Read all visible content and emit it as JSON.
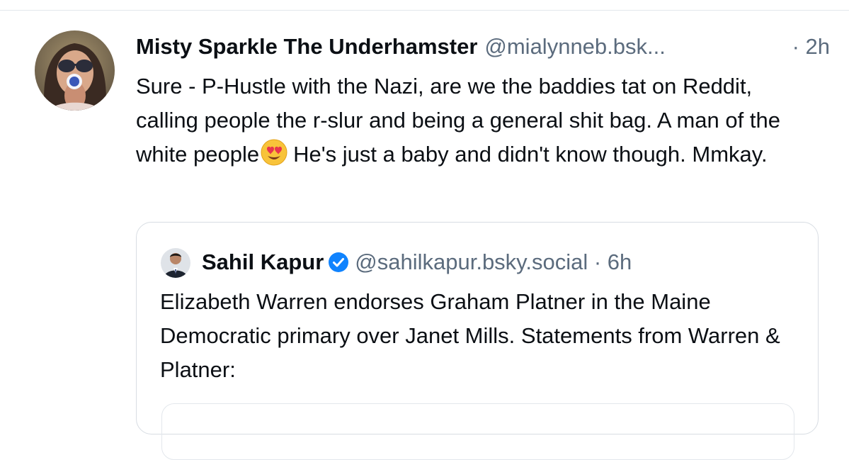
{
  "post": {
    "author_name": "Misty Sparkle The Underhamster",
    "author_handle": "@mialynneb.bsk...",
    "time": "· 2h",
    "text_before_emoji": "Sure - P-Hustle with the Nazi, are we the baddies tat on Reddit, calling people the r-slur and being a general shit bag. A man of the white people",
    "emoji": "heart-eyes-emoji",
    "text_after_emoji": "He's just a baby and didn't know though. Mmkay."
  },
  "quote": {
    "author_name": "Sahil Kapur",
    "verified_icon": "verified-badge-icon",
    "author_handle": "@sahilkapur.bsky.social",
    "time": "· 6h",
    "text": "Elizabeth Warren endorses Graham Platner in the Maine Democratic primary over Janet Mills. Statements from Warren & Platner:"
  },
  "colors": {
    "primary_text": "#0b0f14",
    "secondary_text": "#5b6b7d",
    "verified_blue": "#1083fe",
    "divider": "#e3e7ec"
  }
}
